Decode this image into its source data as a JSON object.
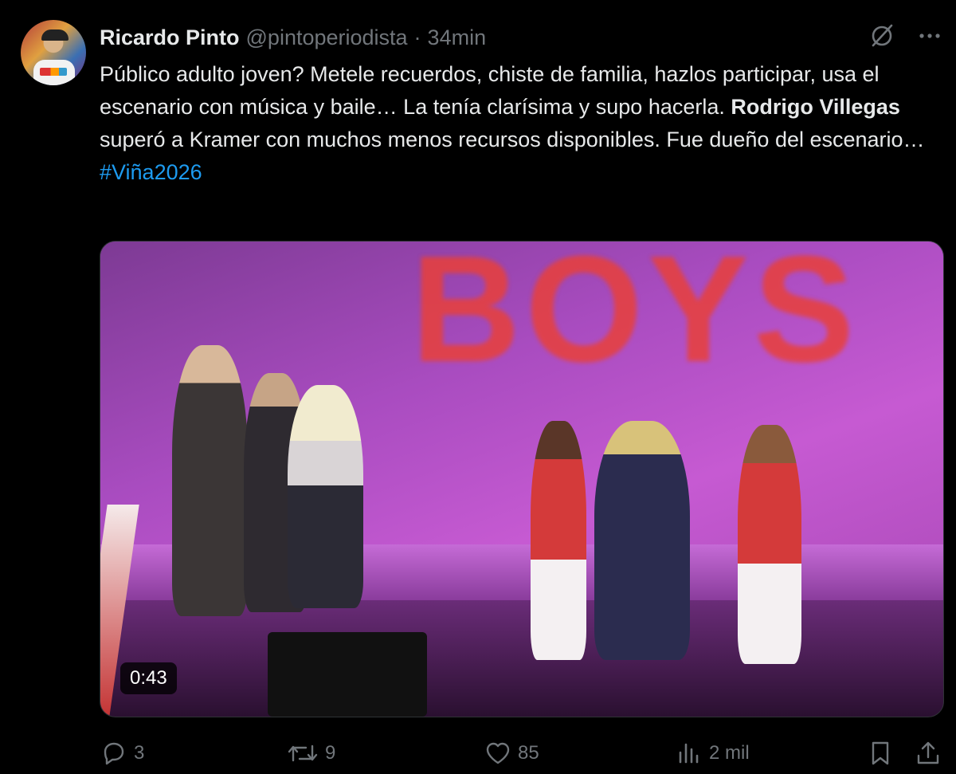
{
  "tweet": {
    "author_name": "Ricardo Pinto",
    "handle": "@pintoperiodista",
    "separator": "·",
    "time": "34min",
    "text_line1": "Público adulto joven? Metele recuerdos, chiste de familia, hazlos participar, usa el escenario con música y baile… La tenía clarísima y supo hacerla.",
    "text_bold": "Rodrigo Villegas",
    "text_line2": " superó a Kramer con muchos menos recursos disponibles. Fue dueño del escenario…",
    "hashtag": "#Viña2026"
  },
  "media": {
    "duration": "0:43",
    "screen_text": "BOYS"
  },
  "actions": {
    "replies": "3",
    "reposts": "9",
    "likes": "85",
    "views": "2 mil"
  },
  "icons": {
    "grok": "grok-icon",
    "more": "more-icon",
    "reply": "reply-icon",
    "repost": "repost-icon",
    "like": "like-icon",
    "views": "views-icon",
    "bookmark": "bookmark-icon",
    "share": "share-icon"
  },
  "colors": {
    "background": "#000000",
    "text": "#e7e9ea",
    "muted": "#71767b",
    "link": "#1d9bf0"
  }
}
